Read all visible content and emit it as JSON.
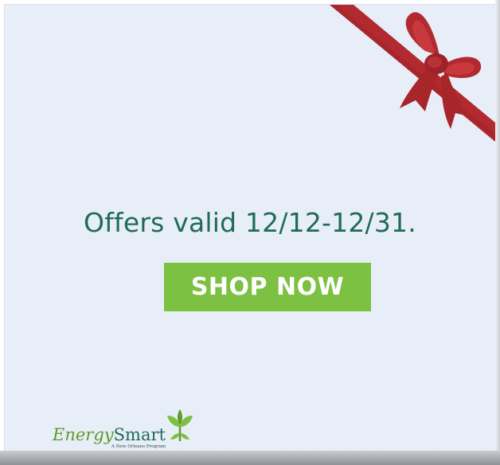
{
  "promo": {
    "headline": "Offers valid 12/12-12/31.",
    "cta_label": "SHOP NOW"
  },
  "logo": {
    "energy": "Energy",
    "smart": "Smart",
    "tagline": "A New Orleans Program",
    "icon": "leaf-sprout-icon"
  },
  "decoration": {
    "icon": "ribbon-bow-icon"
  },
  "colors": {
    "background": "#e8eef8",
    "headline": "#1f6b57",
    "accent": "#7cc142",
    "ribbon": "#b22a2f"
  }
}
